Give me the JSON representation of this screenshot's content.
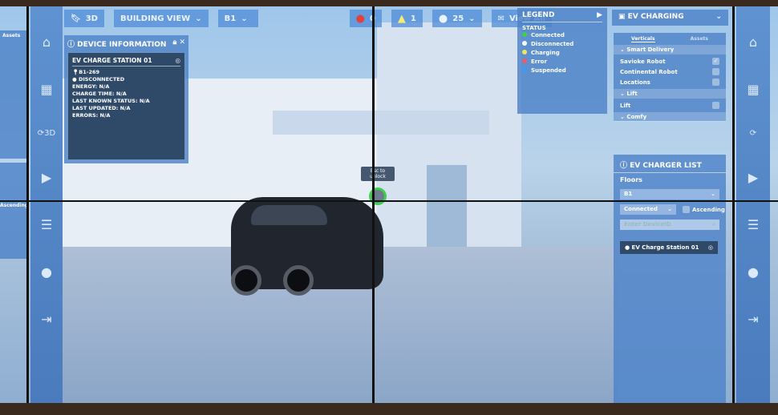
{
  "topbar": {
    "bookmark_icon": "bookmark-icon",
    "mode": "3D",
    "view": "BUILDING VIEW",
    "floor": "B1",
    "error_count": "0",
    "warning_count": "1",
    "info_count": "25",
    "view_all": "View All"
  },
  "device_info": {
    "title": "DEVICE INFORMATION",
    "station": "EV CHARGE STATION 01",
    "location": "B1-269",
    "status": "DISCONNECTED",
    "energy": "ENERGY: N/A",
    "charge_time": "CHARGE TIME: N/A",
    "last_status": "LAST KNOWN STATUS: N/A",
    "last_updated": "LAST UPDATED: N/A",
    "errors": "ERRORS: N/A"
  },
  "legend": {
    "title": "LEGEND",
    "section": "STATUS",
    "items": [
      {
        "label": "Connected",
        "color": "#3fcf4a"
      },
      {
        "label": "Disconnected",
        "color": "#ffffff"
      },
      {
        "label": "Charging",
        "color": "#f1e55a"
      },
      {
        "label": "Error",
        "color": "#ee5a6a"
      },
      {
        "label": "Suspended",
        "color": "#3b9cf5"
      }
    ]
  },
  "ev_charging": {
    "title": "EV CHARGING",
    "tabs": [
      "Verticals",
      "Assets"
    ],
    "groups": [
      {
        "label": "Smart Delivery",
        "items": [
          {
            "label": "Savioke Robot",
            "checked": true
          },
          {
            "label": "Continental Robot",
            "checked": false
          },
          {
            "label": "Locations",
            "checked": false
          }
        ]
      },
      {
        "label": "Lift",
        "items": [
          {
            "label": "Lift",
            "checked": false
          }
        ]
      },
      {
        "label": "Comfy",
        "items": []
      }
    ]
  },
  "charger_list": {
    "title": "EV CHARGER LIST",
    "floors_label": "Floors",
    "floor": "B1",
    "status_filter": "Connected",
    "ascending": "Ascending",
    "search_placeholder": "Enter DeviceID",
    "items": [
      "EV Charge Station 01"
    ]
  },
  "marker": {
    "tooltip": "Esc to unlock"
  }
}
